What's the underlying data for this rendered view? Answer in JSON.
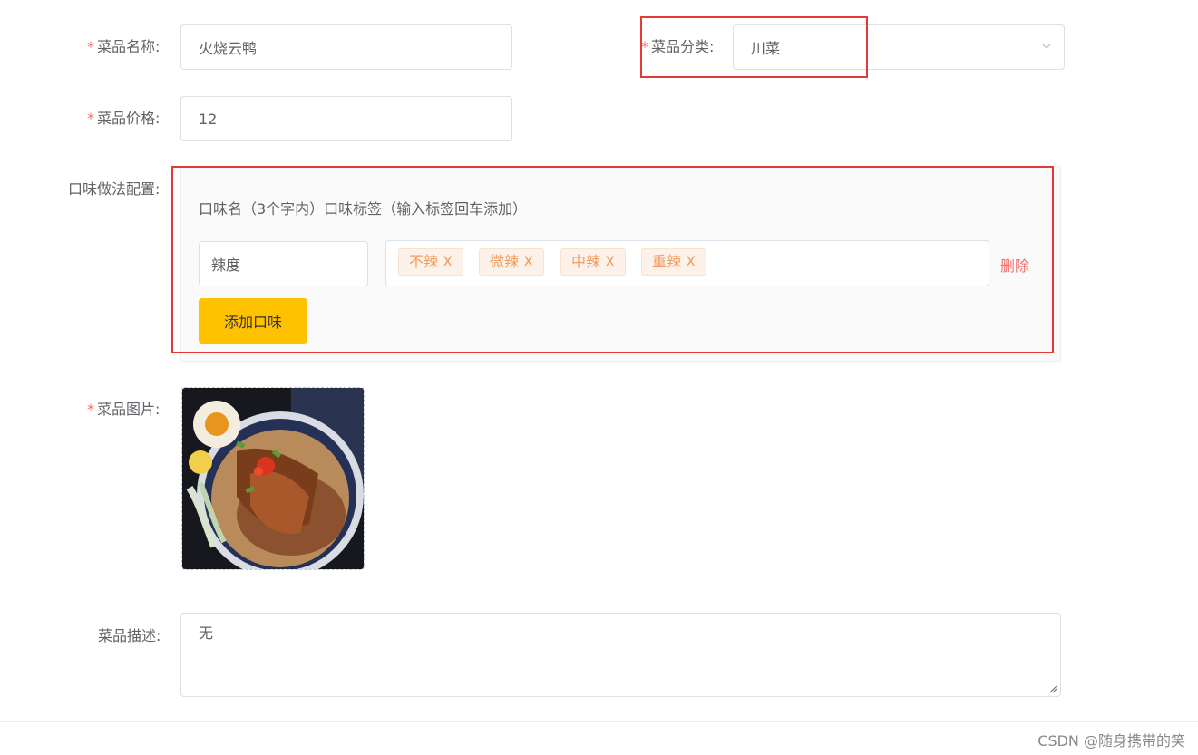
{
  "form": {
    "required_mark": "*",
    "name": {
      "label": "菜品名称:",
      "value": "火烧云鸭"
    },
    "category": {
      "label": "菜品分类:",
      "value": "川菜"
    },
    "price": {
      "label": "菜品价格:",
      "value": "12"
    },
    "flavor": {
      "label": "口味做法配置:",
      "header": "口味名（3个字内）口味标签（输入标签回车添加）",
      "rows": [
        {
          "name": "辣度",
          "tags": [
            "不辣 X",
            "微辣 X",
            "中辣 X",
            "重辣 X"
          ],
          "delete_label": "删除"
        }
      ],
      "add_button": "添加口味"
    },
    "image": {
      "label": "菜品图片:"
    },
    "description": {
      "label": "菜品描述:",
      "value": "无"
    }
  },
  "watermark": "CSDN @随身携带的笑",
  "colors": {
    "required": "#f56c6c",
    "accent": "#ffc200",
    "tag_text": "#f19d62",
    "highlight_box": "#e53935"
  },
  "icons": {
    "select": "chevron-down-icon",
    "textarea": "resize-grip-icon"
  }
}
